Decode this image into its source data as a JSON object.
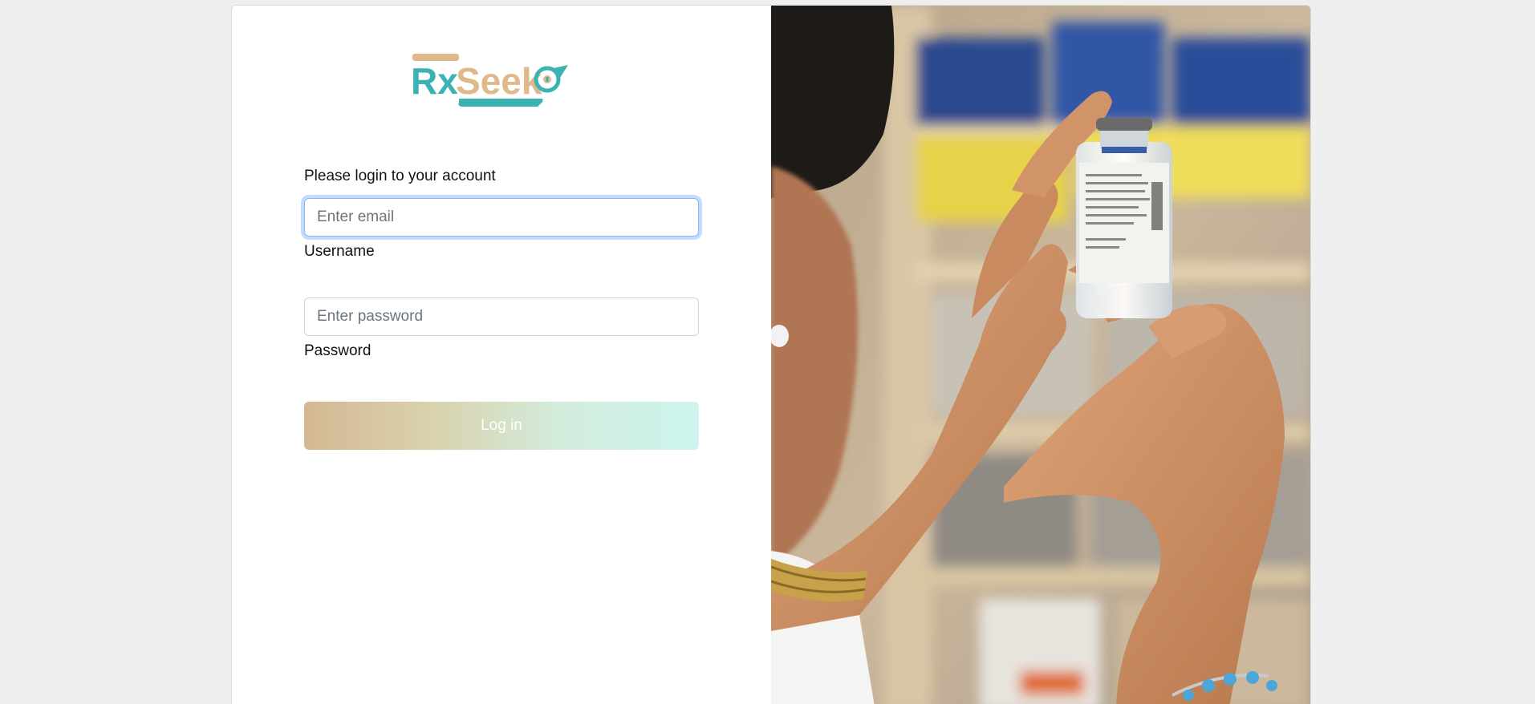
{
  "brand": {
    "logo_text_rx": "Rx",
    "logo_text_seek": "Seek",
    "logo_alt": "RxSeeko",
    "colors": {
      "teal": "#3bb3b4",
      "tan": "#dfb98a"
    }
  },
  "login": {
    "heading": "Please login to your account",
    "email": {
      "placeholder": "Enter email",
      "value": "",
      "label": "Username"
    },
    "password": {
      "placeholder": "Enter password",
      "value": "",
      "label": "Password"
    },
    "submit_label": "Log in"
  },
  "hero_image": {
    "description_icon": "pharmacist-holding-vial-photo"
  }
}
